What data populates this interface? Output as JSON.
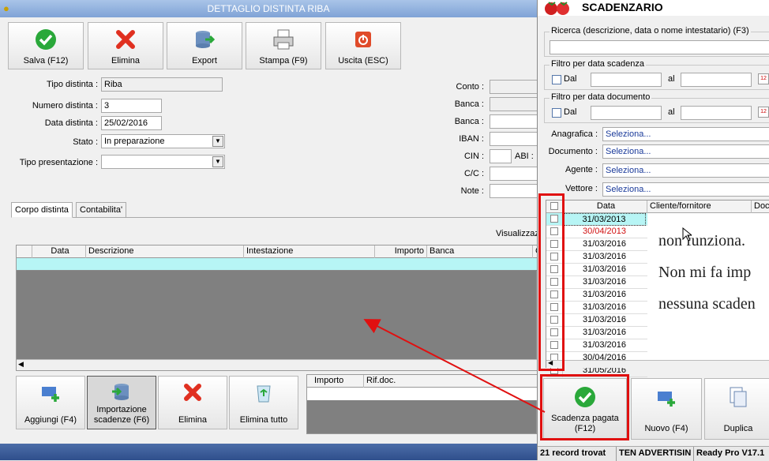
{
  "left_window": {
    "title": "DETTAGLIO DISTINTA RIBA",
    "toolbar": [
      {
        "label": "Salva (F12)",
        "icon": "check-icon"
      },
      {
        "label": "Elimina",
        "icon": "delete-x-icon"
      },
      {
        "label": "Export",
        "icon": "export-icon"
      },
      {
        "label": "Stampa (F9)",
        "icon": "printer-icon"
      },
      {
        "label": "Uscita (ESC)",
        "icon": "exit-icon"
      }
    ],
    "form": {
      "tipo_distinta_label": "Tipo distinta :",
      "tipo_distinta_value": "Riba",
      "numero_distinta_label": "Numero distinta :",
      "numero_distinta_value": "3",
      "data_distinta_label": "Data distinta :",
      "data_distinta_value": "25/02/2016",
      "stato_label": "Stato :",
      "stato_value": "In preparazione",
      "tipo_presentazione_label": "Tipo presentazione :",
      "tipo_presentazione_value": "",
      "conto_label": "Conto :",
      "banca1_label": "Banca :",
      "banca2_label": "Banca :",
      "iban_label": "IBAN :",
      "cin_label": "CIN :",
      "abi_label": "ABI :",
      "cc_label": "C/C :",
      "note_label": "Note :"
    },
    "tabs": [
      "Corpo distinta",
      "Contabilita'"
    ],
    "visualizza_label": "Visualizzaz",
    "grid_headers": [
      "Data",
      "Descrizione",
      "Intestazione",
      "Importo",
      "Banca",
      "C"
    ],
    "bottom_buttons": [
      {
        "label": "Aggiungi (F4)",
        "icon": "add-icon"
      },
      {
        "label": "Importazione scadenze (F6)",
        "icon": "import-icon"
      },
      {
        "label": "Elimina",
        "icon": "delete-x-icon"
      },
      {
        "label": "Elimina tutto",
        "icon": "recycle-bin-icon"
      }
    ],
    "sub_grid_headers": [
      "Importo",
      "Rif.doc."
    ]
  },
  "right_window": {
    "title": "SCADENZARIO",
    "search_caption": "Ricerca (descrizione, data o nome intestatario) (F3)",
    "filter_scadenza_caption": "Filtro per data scadenza",
    "filter_documento_caption": "Filtro per data documento",
    "dal_label": "Dal",
    "al_label": "al",
    "anagrafica_label": "Anagrafica :",
    "documento_label": "Documento :",
    "agente_label": "Agente :",
    "vettore_label": "Vettore :",
    "select_placeholder": "Seleziona...",
    "grid_headers": [
      "Data",
      "Cliente/fornitore",
      "Docu"
    ],
    "rows": [
      {
        "date": "31/03/2013",
        "red": false
      },
      {
        "date": "30/04/2013",
        "red": true
      },
      {
        "date": "31/03/2016",
        "red": false
      },
      {
        "date": "31/03/2016",
        "red": false
      },
      {
        "date": "31/03/2016",
        "red": false
      },
      {
        "date": "31/03/2016",
        "red": false
      },
      {
        "date": "31/03/2016",
        "red": false
      },
      {
        "date": "31/03/2016",
        "red": false
      },
      {
        "date": "31/03/2016",
        "red": false
      },
      {
        "date": "31/03/2016",
        "red": false
      },
      {
        "date": "31/03/2016",
        "red": false
      },
      {
        "date": "30/04/2016",
        "red": false
      },
      {
        "date": "31/05/2016",
        "red": false
      }
    ],
    "note_lines": [
      "non funziona.",
      "Non mi fa imp",
      "nessuna scaden"
    ],
    "buttons": [
      {
        "label": "Scadenza pagata (F12)",
        "icon": "check-icon"
      },
      {
        "label": "Nuovo (F4)",
        "icon": "add-icon"
      },
      {
        "label": "Duplica",
        "icon": "duplicate-icon"
      }
    ],
    "status": [
      "21 record trovat",
      "TEN ADVERTISIN",
      "Ready Pro V17.1"
    ]
  },
  "colors": {
    "annotation": "#e01010",
    "selected_row": "#b7f5f5",
    "date_red": "#d01010"
  }
}
